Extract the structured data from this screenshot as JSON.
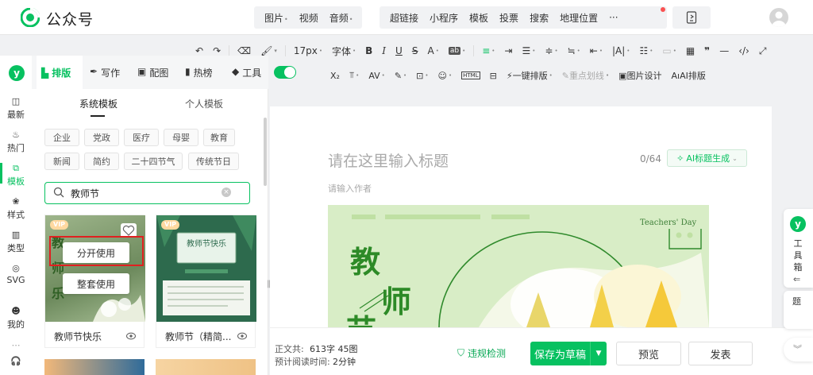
{
  "app": {
    "brand": "公众号"
  },
  "top_menu": {
    "group1": [
      "图片",
      "视频",
      "音频"
    ],
    "group2": [
      "超链接",
      "小程序",
      "模板",
      "投票",
      "搜索",
      "地理位置",
      "···"
    ]
  },
  "format_toolbar": {
    "font_size": "17px",
    "font_family": "字体",
    "row2_labels": {
      "one_key": "一键排版",
      "highlight": "重点划线",
      "img_design": "图片设计",
      "ai_layout": "AI排版"
    }
  },
  "rail": {
    "items": [
      {
        "label": "最新",
        "icon": "latest-icon"
      },
      {
        "label": "热门",
        "icon": "flame-icon"
      },
      {
        "label": "模板",
        "icon": "template-icon",
        "active": true
      },
      {
        "label": "样式",
        "icon": "style-icon"
      },
      {
        "label": "类型",
        "icon": "type-icon"
      },
      {
        "label": "SVG",
        "icon": "svg-icon"
      },
      {
        "label": "我的",
        "icon": "user-icon"
      }
    ]
  },
  "panel": {
    "tabs": [
      "排版",
      "写作",
      "配图",
      "热榜",
      "工具"
    ],
    "subtabs": {
      "system": "系统模板",
      "personal": "个人模板"
    },
    "chips": [
      "企业",
      "党政",
      "医疗",
      "母婴",
      "教育",
      "新闻",
      "简约",
      "二十四节气",
      "传统节日"
    ],
    "search_value": "教师节",
    "overlay_buttons": {
      "split": "分开使用",
      "whole": "整套使用"
    },
    "cards": [
      {
        "title": "教师节快乐",
        "vip": "VIP"
      },
      {
        "title": "教师节（精简...",
        "vip": "VIP",
        "inner_title": "教师节快乐"
      }
    ]
  },
  "editor": {
    "title_placeholder": "请在这里输入标题",
    "title_counter": "0/64",
    "ai_title_button": "AI标题生成",
    "author_placeholder": "请输入作者",
    "banner": {
      "en_text": "Teachers' Day",
      "cn_text": [
        "教",
        "师",
        "节"
      ]
    }
  },
  "bottom": {
    "word_count_label": "正文共:",
    "word_count_value": "613字 45图",
    "read_time_label": "预计阅读时间:",
    "read_time_value": "2分钟",
    "check_label": "违规检测",
    "save_label": "保存为草稿",
    "preview_label": "预览",
    "publish_label": "发表"
  },
  "right_float": {
    "tool_label": [
      "工",
      "具",
      "箱"
    ],
    "item2": "题"
  },
  "colors": {
    "accent": "#07c160",
    "danger": "#e02020"
  }
}
